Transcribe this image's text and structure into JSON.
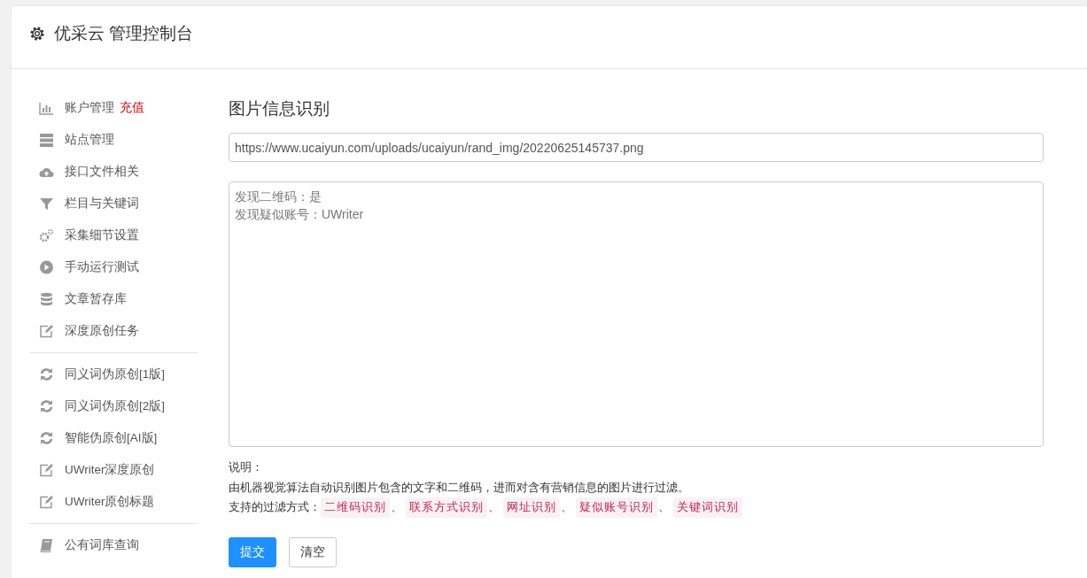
{
  "header": {
    "title": "优采云 管理控制台"
  },
  "sidebar": {
    "groups": [
      {
        "items": [
          {
            "kind": "chart",
            "label": "账户管理",
            "badge": "充值"
          },
          {
            "kind": "server",
            "label": "站点管理"
          },
          {
            "kind": "cloud-upload",
            "label": "接口文件相关"
          },
          {
            "kind": "filter",
            "label": "栏目与关键词"
          },
          {
            "kind": "cogs",
            "label": "采集细节设置"
          },
          {
            "kind": "play",
            "label": "手动运行测试"
          },
          {
            "kind": "database",
            "label": "文章暂存库"
          },
          {
            "kind": "edit",
            "label": "深度原创任务"
          }
        ]
      },
      {
        "items": [
          {
            "kind": "refresh",
            "label": "同义词伪原创[1版]"
          },
          {
            "kind": "refresh",
            "label": "同义词伪原创[2版]"
          },
          {
            "kind": "refresh",
            "label": "智能伪原创[AI版]"
          },
          {
            "kind": "edit",
            "label": "UWriter深度原创"
          },
          {
            "kind": "edit",
            "label": "UWriter原创标题"
          }
        ]
      },
      {
        "items": [
          {
            "kind": "book",
            "label": "公有词库查询"
          }
        ]
      }
    ]
  },
  "main": {
    "heading": "图片信息识别",
    "url_field": {
      "value": "https://www.ucaiyun.com/uploads/ucaiyun/rand_img/20220625145737.png"
    },
    "result_box": {
      "lines": [
        "发现二维码：是",
        "发现疑似账号：UWriter"
      ]
    },
    "notes": {
      "label": "说明：",
      "description": "由机器视觉算法自动识别图片包含的文字和二维码，进而对含有营销信息的图片进行过滤。",
      "filters_label": "支持的过滤方式：",
      "filters": [
        {
          "label": "二维码识别",
          "separator": "、"
        },
        {
          "label": "联系方式识别",
          "separator": "、"
        },
        {
          "label": "网址识别",
          "separator": "、"
        },
        {
          "label": "疑似账号识别",
          "separator": "、"
        },
        {
          "label": "关键词识别"
        }
      ]
    },
    "buttons": [
      {
        "label": "提交",
        "kind": "primary"
      },
      {
        "label": "清空",
        "kind": "default"
      }
    ]
  }
}
